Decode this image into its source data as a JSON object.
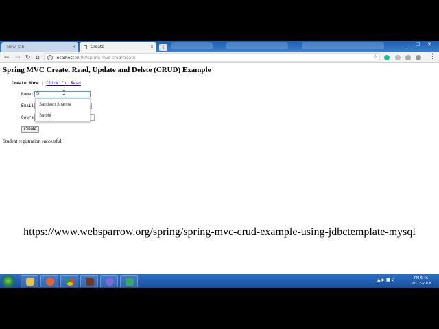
{
  "browser": {
    "tabs": [
      {
        "title": "New Tab",
        "close": "×"
      },
      {
        "title": "Create",
        "close": "×"
      }
    ],
    "new_tab": "+",
    "window_controls": {
      "minimize": "–",
      "maximize": "☐",
      "close": "✕"
    },
    "url_host": "localhost",
    "url_path": ":8090/spring-mvc-crud/create",
    "icons": [
      "back-icon",
      "forward-icon",
      "reload-icon",
      "home-icon",
      "info-icon",
      "star-icon",
      "menu-icon"
    ]
  },
  "page": {
    "title": "Spring MVC Create, Read, Update and Delete (CRUD) Example",
    "create_more": "Create More",
    "separator": " | ",
    "read_link": "Click for Read",
    "form": {
      "name_label": "Name:",
      "name_value": "S",
      "email_label": "Email:",
      "course_label": "Course:",
      "submit": "Create"
    },
    "autocomplete": [
      "Sandeep Sharma",
      "Surbhi"
    ],
    "success": "Student registration successful."
  },
  "reference_url": "https://www.websparrow.org/spring/spring-mvc-crud-example-using-jdbctemplate-mysql",
  "taskbar": {
    "time": "PM 6:46",
    "date": "02-12-2018",
    "accent": "#1b4f98"
  }
}
